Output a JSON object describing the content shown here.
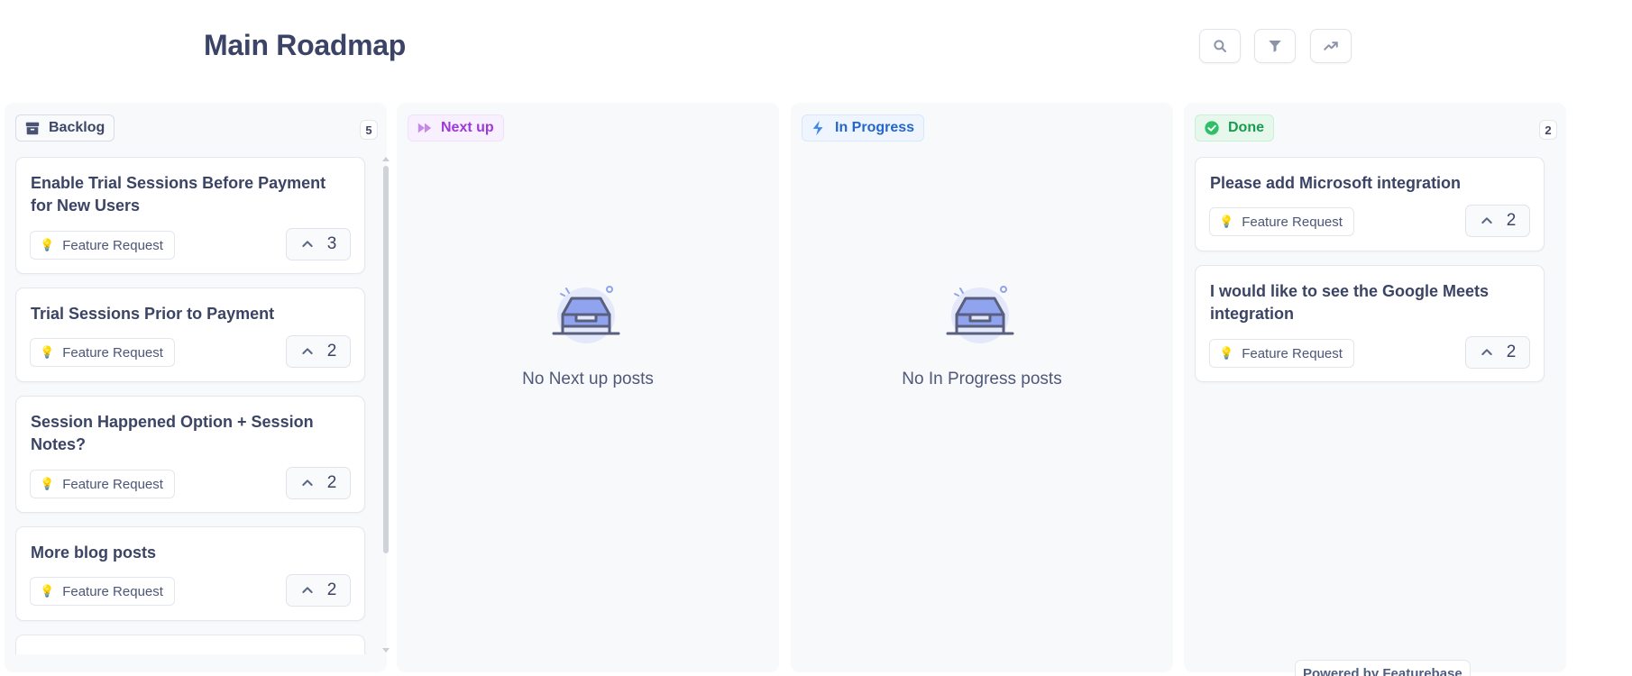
{
  "header": {
    "title": "Main Roadmap"
  },
  "toolbar": {
    "search_icon": "search-icon",
    "filter_icon": "filter-icon",
    "trending_icon": "trending-icon"
  },
  "columns": [
    {
      "name": "Backlog",
      "count": "5",
      "icon": "archive-icon",
      "color": "#3d4667",
      "posts": [
        {
          "title": "Enable Trial Sessions Before Payment for New Users",
          "tag": "Feature Request",
          "votes": "3"
        },
        {
          "title": "Trial Sessions Prior to Payment",
          "tag": "Feature Request",
          "votes": "2"
        },
        {
          "title": "Session Happened Option + Session Notes?",
          "tag": "Feature Request",
          "votes": "2"
        },
        {
          "title": "More blog posts",
          "tag": "Feature Request",
          "votes": "2"
        }
      ]
    },
    {
      "name": "Next up",
      "icon": "fast-forward-icon",
      "color": "#9c3ad8",
      "empty_text": "No Next up posts"
    },
    {
      "name": "In Progress",
      "icon": "lightning-icon",
      "color": "#2566c9",
      "empty_text": "No In Progress posts"
    },
    {
      "name": "Done",
      "count": "2",
      "icon": "check-circle-icon",
      "color": "#1a9a4e",
      "posts": [
        {
          "title": "Please add Microsoft integration",
          "tag": "Feature Request",
          "votes": "2"
        },
        {
          "title": "I would like to see the Google Meets integration",
          "tag": "Feature Request",
          "votes": "2"
        }
      ]
    }
  ],
  "footer": {
    "powered_by": "Powered by Featurebase"
  }
}
